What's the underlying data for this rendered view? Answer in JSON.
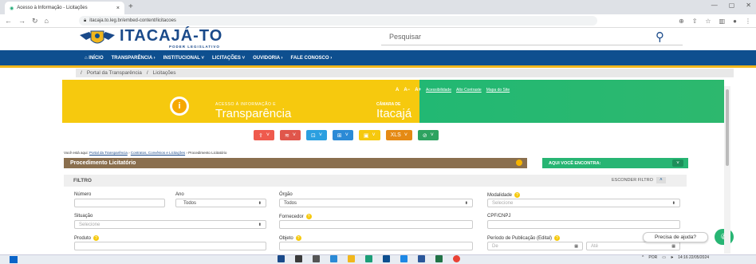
{
  "browser": {
    "tab_title": "Acesso à Informação - Licitações",
    "url": "itacaja.to.leg.br/embed-content/licitacoes",
    "new_tab": "+",
    "tab_close": "×",
    "nav_icons": [
      "back-icon",
      "forward-icon",
      "reload-icon",
      "home-icon"
    ],
    "win": [
      "—",
      "▢",
      "✕"
    ]
  },
  "header": {
    "logo_title": "ITACAJÁ-TO",
    "logo_subtitle": "PODER LEGISLATIVO",
    "search_placeholder": "Pesquisar",
    "search_icon": "🔍"
  },
  "nav": {
    "items": [
      "⌂ INÍCIO",
      "TRANSPARÊNCIA ›",
      "INSTITUCIONAL ˅",
      "LICITAÇÕES ˅",
      "OUVIDORIA ›",
      "FALE CONOSCO ›"
    ]
  },
  "breadcrumb": [
    "/",
    "Portal da Transparência",
    "/",
    "Licitações"
  ],
  "banner": {
    "left_small": "ACESSO À INFORMAÇÃO E",
    "left_big": "Transparência",
    "right_small": "CÂMARA DE",
    "right_big": "Itacajá",
    "accessibility": [
      "A",
      "A−",
      "A+",
      "Acessibilidade",
      "Alto Contraste",
      "Mapa do Site"
    ]
  },
  "toolbar_buttons": [
    {
      "icon": "⇪",
      "color": "#ef5a4d"
    },
    {
      "icon": "≋",
      "color": "#e0564b"
    },
    {
      "icon": "⊡",
      "color": "#2b9fe0"
    },
    {
      "icon": "⊞",
      "color": "#2b8ad6"
    },
    {
      "icon": "▣",
      "color": "#f6c90e"
    },
    {
      "icon": "XLS",
      "color": "#e58a14"
    },
    {
      "icon": "⊘",
      "color": "#2da360"
    }
  ],
  "crumb2": {
    "prefix": "Você está aqui:",
    "l1": "Portal da Transparência",
    "l2": "Contratos, Convênios e Licitações",
    "l3": "Procedimento Licitatório"
  },
  "panel": {
    "title": "Procedimento Licitatório",
    "aqui": "AQUI VOCÊ ENCONTRA:",
    "filtro": "FILTRO",
    "esconder": "ESCONDER FILTRO"
  },
  "filters": {
    "numero": "Número",
    "ano": "Ano",
    "ano_value": "Todos",
    "orgao": "Órgão",
    "orgao_value": "Todos",
    "modalidade": "Modalidade",
    "modalidade_value": "Selecione",
    "situacao": "Situação",
    "situacao_value": "Selecione",
    "fornecedor": "Fornecedor",
    "cpf": "CPF/CNPJ",
    "produto": "Produto",
    "objeto": "Objeto",
    "periodo": "Período de Publicação (Edital)",
    "de": "De",
    "ate": "Até"
  },
  "chat": {
    "bubble": "Precisa de ajuda?",
    "icon": "💬"
  },
  "taskbar": {
    "time": "14:16",
    "date": "22/05/2024",
    "lang": "POR"
  }
}
